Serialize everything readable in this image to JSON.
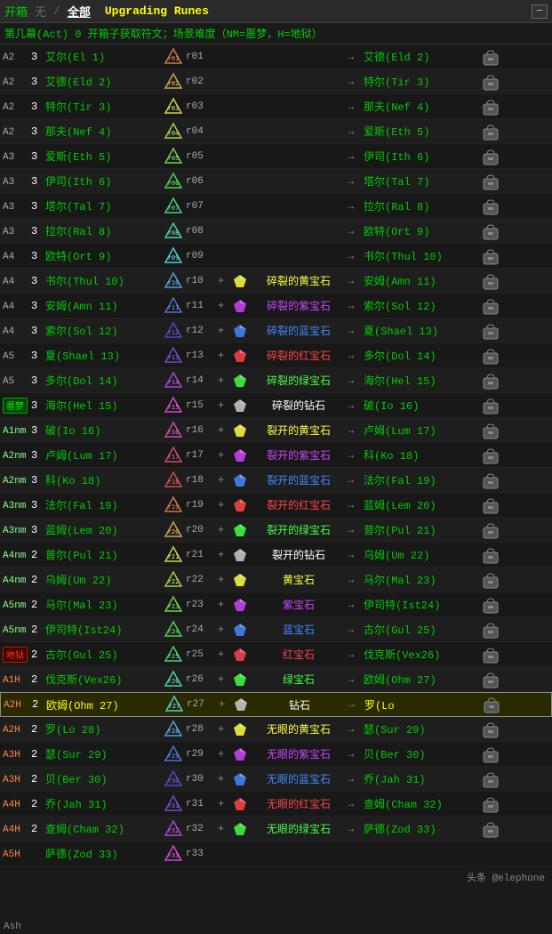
{
  "header": {
    "title": "开箱",
    "tabs": [
      "无",
      "全部"
    ],
    "active_tab": "全部",
    "subtitle": "Upgrading Runes"
  },
  "sub_header": {
    "text": "第几幕(Act)  0  开箱子获取符文；场景难度（NM=噩梦，H=地狱）"
  },
  "rows": [
    {
      "level": "A2",
      "qty": "3",
      "name": "艾尔(El",
      "num": "1)",
      "rune": "r01",
      "gem": "",
      "arrow": "→",
      "result": "艾德(Eld",
      "rnum": "2)",
      "highlight": false,
      "difficulty": ""
    },
    {
      "level": "A2",
      "qty": "3",
      "name": "艾德(Eld",
      "num": "2)",
      "rune": "r02",
      "gem": "",
      "arrow": "→",
      "result": "特尔(Tir",
      "rnum": "3)",
      "highlight": false,
      "difficulty": ""
    },
    {
      "level": "A2",
      "qty": "3",
      "name": "特尔(Tir",
      "num": "3)",
      "rune": "r03",
      "gem": "",
      "arrow": "→",
      "result": "那夫(Nef",
      "rnum": "4)",
      "highlight": false,
      "difficulty": ""
    },
    {
      "level": "A2",
      "qty": "3",
      "name": "那夫(Nef",
      "num": "4)",
      "rune": "r04",
      "gem": "",
      "arrow": "→",
      "result": "爱斯(Eth",
      "rnum": "5)",
      "highlight": false,
      "difficulty": ""
    },
    {
      "level": "A3",
      "qty": "3",
      "name": "爱斯(Eth",
      "num": "5)",
      "rune": "r05",
      "gem": "",
      "arrow": "→",
      "result": "伊司(Ith",
      "rnum": "6)",
      "highlight": false,
      "difficulty": ""
    },
    {
      "level": "A3",
      "qty": "3",
      "name": "伊司(Ith",
      "num": "6)",
      "rune": "r06",
      "gem": "",
      "arrow": "→",
      "result": "塔尔(Tal",
      "rnum": "7)",
      "highlight": false,
      "difficulty": ""
    },
    {
      "level": "A3",
      "qty": "3",
      "name": "塔尔(Tal",
      "num": "7)",
      "rune": "r07",
      "gem": "",
      "arrow": "→",
      "result": "拉尔(Ral",
      "rnum": "8)",
      "highlight": false,
      "difficulty": ""
    },
    {
      "level": "A3",
      "qty": "3",
      "name": "拉尔(Ral",
      "num": "8)",
      "rune": "r08",
      "gem": "",
      "arrow": "→",
      "result": "欧特(Ort",
      "rnum": "9)",
      "highlight": false,
      "difficulty": ""
    },
    {
      "level": "A4",
      "qty": "3",
      "name": "欧特(Ort",
      "num": "9)",
      "rune": "r09",
      "gem": "",
      "arrow": "→",
      "result": "书尔(Thul",
      "rnum": "10)",
      "highlight": false,
      "difficulty": ""
    },
    {
      "level": "A4",
      "qty": "3",
      "name": "书尔(Thul",
      "num": "10)",
      "rune": "r10",
      "gem": "碎裂的黄宝石",
      "gemcolor": "gem-yellow",
      "arrow": "→",
      "result": "安姆(Amn",
      "rnum": "11)",
      "highlight": false,
      "difficulty": ""
    },
    {
      "level": "A4",
      "qty": "3",
      "name": "安姆(Amn",
      "num": "11)",
      "rune": "r11",
      "gem": "碎裂的紫宝石",
      "gemcolor": "gem-purple",
      "arrow": "→",
      "result": "索尔(Sol",
      "rnum": "12)",
      "highlight": false,
      "difficulty": ""
    },
    {
      "level": "A4",
      "qty": "3",
      "name": "索尔(Sol",
      "num": "12)",
      "rune": "r12",
      "gem": "碎裂的蓝宝石",
      "gemcolor": "gem-blue",
      "arrow": "→",
      "result": "夏(Shael",
      "rnum": "13)",
      "highlight": false,
      "difficulty": ""
    },
    {
      "level": "A5",
      "qty": "3",
      "name": "夏(Shael",
      "num": "13)",
      "rune": "r13",
      "gem": "碎裂的红宝石",
      "gemcolor": "gem-red",
      "arrow": "→",
      "result": "多尔(Dol",
      "rnum": "14)",
      "highlight": false,
      "difficulty": ""
    },
    {
      "level": "A5",
      "qty": "3",
      "name": "多尔(Dol",
      "num": "14)",
      "rune": "r14",
      "gem": "碎裂的绿宝石",
      "gemcolor": "gem-green",
      "arrow": "→",
      "result": "海尔(Hel",
      "rnum": "15)",
      "highlight": false,
      "difficulty": ""
    },
    {
      "level": "噩梦",
      "qty": "3",
      "name": "海尔(Hel",
      "num": "15)",
      "rune": "r15",
      "gem": "碎裂的钻石",
      "gemcolor": "gem-white",
      "arrow": "→",
      "result": "破(Io",
      "rnum": "16)",
      "highlight": false,
      "difficulty": "nm"
    },
    {
      "level": "A1nm",
      "qty": "3",
      "name": "破(Io",
      "num": "16)",
      "rune": "r16",
      "gem": "裂开的黄宝石",
      "gemcolor": "gem-yellow",
      "arrow": "→",
      "result": "卢姆(Lum",
      "rnum": "17)",
      "highlight": false,
      "difficulty": "nm"
    },
    {
      "level": "A2nm",
      "qty": "3",
      "name": "卢姆(Lum",
      "num": "17)",
      "rune": "r17",
      "gem": "裂开的紫宝石",
      "gemcolor": "gem-purple",
      "arrow": "→",
      "result": "科(Ko",
      "rnum": "18)",
      "highlight": false,
      "difficulty": "nm"
    },
    {
      "level": "A2nm",
      "qty": "3",
      "name": "科(Ko",
      "num": "18)",
      "rune": "r18",
      "gem": "裂开的蓝宝石",
      "gemcolor": "gem-blue",
      "arrow": "→",
      "result": "法尔(Fal",
      "rnum": "19)",
      "highlight": false,
      "difficulty": "nm"
    },
    {
      "level": "A3nm",
      "qty": "3",
      "name": "法尔(Fal",
      "num": "19)",
      "rune": "r19",
      "gem": "裂开的红宝石",
      "gemcolor": "gem-red",
      "arrow": "→",
      "result": "蓝姆(Lem",
      "rnum": "20)",
      "highlight": false,
      "difficulty": "nm"
    },
    {
      "level": "A3nm",
      "qty": "3",
      "name": "蓝姆(Lem",
      "num": "20)",
      "rune": "r20",
      "gem": "裂开的绿宝石",
      "gemcolor": "gem-green",
      "arrow": "→",
      "result": "普尔(Pul",
      "rnum": "21)",
      "highlight": false,
      "difficulty": "nm"
    },
    {
      "level": "A4nm",
      "qty": "2",
      "name": "普尔(Pul",
      "num": "21)",
      "rune": "r21",
      "gem": "裂开的钻石",
      "gemcolor": "gem-white",
      "arrow": "→",
      "result": "乌姆(Um",
      "rnum": "22)",
      "highlight": false,
      "difficulty": "nm"
    },
    {
      "level": "A4nm",
      "qty": "2",
      "name": "乌姆(Um",
      "num": "22)",
      "rune": "r22",
      "gem": "黄宝石",
      "gemcolor": "gem-yellow",
      "arrow": "→",
      "result": "马尔(Mal",
      "rnum": "23)",
      "highlight": false,
      "difficulty": "nm"
    },
    {
      "level": "A5nm",
      "qty": "2",
      "name": "马尔(Mal",
      "num": "23)",
      "rune": "r23",
      "gem": "紫宝石",
      "gemcolor": "gem-purple",
      "arrow": "→",
      "result": "伊司特(Ist24)",
      "rnum": "",
      "highlight": false,
      "difficulty": "nm"
    },
    {
      "level": "A5nm",
      "qty": "2",
      "name": "伊司特(Ist24)",
      "num": "",
      "rune": "r24",
      "gem": "蓝宝石",
      "gemcolor": "gem-blue",
      "arrow": "→",
      "result": "古尔(Gul",
      "rnum": "25)",
      "highlight": false,
      "difficulty": "nm"
    },
    {
      "level": "地狱",
      "qty": "2",
      "name": "古尔(Gul",
      "num": "25)",
      "rune": "r25",
      "gem": "红宝石",
      "gemcolor": "gem-red",
      "arrow": "→",
      "result": "伐克斯(Vex26)",
      "rnum": "",
      "highlight": false,
      "difficulty": "hell"
    },
    {
      "level": "A1H",
      "qty": "2",
      "name": "伐克斯(Vex26)",
      "num": "",
      "rune": "r26",
      "gem": "绿宝石",
      "gemcolor": "gem-green",
      "arrow": "→",
      "result": "欧姆(Ohm",
      "rnum": "27)",
      "highlight": false,
      "difficulty": "hell"
    },
    {
      "level": "A2H",
      "qty": "2",
      "name": "欧姆(Ohm",
      "num": "27)",
      "rune": "r27",
      "gem": "钻石",
      "gemcolor": "gem-white",
      "arrow": "→",
      "result": "罗(Lo",
      "rnum": "",
      "highlight": true,
      "difficulty": "hell"
    },
    {
      "level": "A2H",
      "qty": "2",
      "name": "罗(Lo",
      "num": "28)",
      "rune": "r28",
      "gem": "无眼的黄宝石",
      "gemcolor": "gem-yellow",
      "arrow": "→",
      "result": "瑟(Sur",
      "rnum": "29)",
      "highlight": false,
      "difficulty": "hell"
    },
    {
      "level": "A3H",
      "qty": "2",
      "name": "瑟(Sur",
      "num": "29)",
      "rune": "r29",
      "gem": "无眼的紫宝石",
      "gemcolor": "gem-purple",
      "arrow": "→",
      "result": "贝(Ber",
      "rnum": "30)",
      "highlight": false,
      "difficulty": "hell"
    },
    {
      "level": "A3H",
      "qty": "2",
      "name": "贝(Ber",
      "num": "30)",
      "rune": "r30",
      "gem": "无眼的蓝宝石",
      "gemcolor": "gem-blue",
      "arrow": "→",
      "result": "乔(Jah",
      "rnum": "31)",
      "highlight": false,
      "difficulty": "hell"
    },
    {
      "level": "A4H",
      "qty": "2",
      "name": "乔(Jah",
      "num": "31)",
      "rune": "r31",
      "gem": "无眼的红宝石",
      "gemcolor": "gem-red",
      "arrow": "→",
      "result": "查姆(Cham",
      "rnum": "32)",
      "highlight": false,
      "difficulty": "hell"
    },
    {
      "level": "A4H",
      "qty": "2",
      "name": "查姆(Cham",
      "num": "32)",
      "rune": "r32",
      "gem": "无眼的绿宝石",
      "gemcolor": "gem-green",
      "arrow": "→",
      "result": "萨德(Zod",
      "rnum": "33)",
      "highlight": false,
      "difficulty": "hell"
    },
    {
      "level": "A5H",
      "qty": "",
      "name": "萨德(Zod",
      "num": "33)",
      "rune": "r33",
      "gem": "",
      "gemcolor": "",
      "arrow": "",
      "result": "",
      "rnum": "",
      "highlight": false,
      "difficulty": "hell"
    }
  ],
  "footer": {
    "text": "头条 @elephone"
  },
  "bottom_label": "Ash"
}
